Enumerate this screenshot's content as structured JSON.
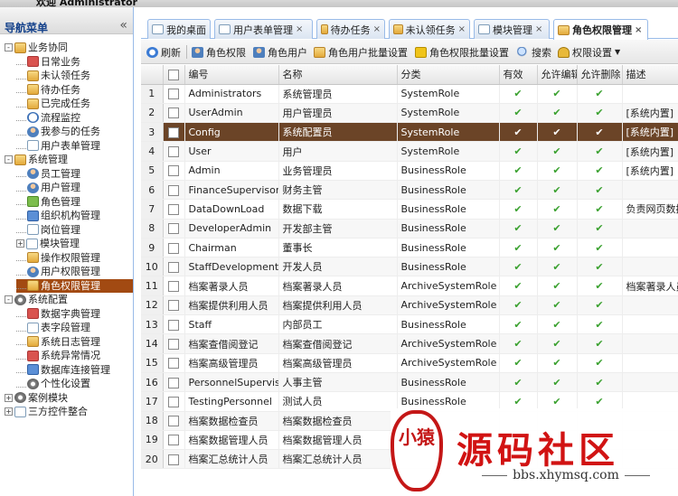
{
  "header": {
    "welcome": "欢迎 Administrator"
  },
  "nav": {
    "title": "导航菜单",
    "collapse_glyph": "«",
    "tree": [
      {
        "label": "业务协同",
        "level": 0,
        "toggle": "-",
        "icon": "folder"
      },
      {
        "label": "日常业务",
        "level": 1,
        "icon": "red"
      },
      {
        "label": "未认领任务",
        "level": 1,
        "icon": "folder"
      },
      {
        "label": "待办任务",
        "level": 1,
        "icon": "folder"
      },
      {
        "label": "已完成任务",
        "level": 1,
        "icon": "folder"
      },
      {
        "label": "流程监控",
        "level": 1,
        "icon": "clock"
      },
      {
        "label": "我参与的任务",
        "level": 1,
        "icon": "user"
      },
      {
        "label": "用户表单管理",
        "level": 1,
        "icon": "page"
      },
      {
        "label": "系统管理",
        "level": 0,
        "toggle": "-",
        "icon": "folder"
      },
      {
        "label": "员工管理",
        "level": 1,
        "icon": "user"
      },
      {
        "label": "用户管理",
        "level": 1,
        "icon": "user"
      },
      {
        "label": "角色管理",
        "level": 1,
        "icon": "green"
      },
      {
        "label": "组织机构管理",
        "level": 1,
        "icon": "blue"
      },
      {
        "label": "岗位管理",
        "level": 1,
        "icon": "page"
      },
      {
        "label": "模块管理",
        "level": 1,
        "toggle": "+",
        "icon": "page"
      },
      {
        "label": "操作权限管理",
        "level": 1,
        "icon": "folder"
      },
      {
        "label": "用户权限管理",
        "level": 1,
        "icon": "user"
      },
      {
        "label": "角色权限管理",
        "level": 1,
        "icon": "folder",
        "selected": true
      },
      {
        "label": "系统配置",
        "level": 0,
        "toggle": "-",
        "icon": "gear"
      },
      {
        "label": "数据字典管理",
        "level": 1,
        "icon": "red"
      },
      {
        "label": "表字段管理",
        "level": 1,
        "icon": "page"
      },
      {
        "label": "系统日志管理",
        "level": 1,
        "icon": "folder"
      },
      {
        "label": "系统异常情况",
        "level": 1,
        "icon": "red"
      },
      {
        "label": "数据库连接管理",
        "level": 1,
        "icon": "blue"
      },
      {
        "label": "个性化设置",
        "level": 1,
        "icon": "gear"
      },
      {
        "label": "案例模块",
        "level": 0,
        "toggle": "+",
        "icon": "gear"
      },
      {
        "label": "三方控件整合",
        "level": 0,
        "toggle": "+",
        "icon": "page"
      }
    ]
  },
  "tabs": [
    {
      "label": "我的桌面",
      "icon": "page",
      "closable": false
    },
    {
      "label": "用户表单管理",
      "icon": "page",
      "closable": true
    },
    {
      "label": "待办任务",
      "icon": "folder",
      "closable": true
    },
    {
      "label": "未认领任务",
      "icon": "folder",
      "closable": true
    },
    {
      "label": "模块管理",
      "icon": "page",
      "closable": true
    },
    {
      "label": "角色权限管理",
      "icon": "folder",
      "closable": true,
      "active": true
    }
  ],
  "toolbar": {
    "refresh": "刷新",
    "role_permission": "角色权限",
    "role_user": "角色用户",
    "role_user_batch": "角色用户批量设置",
    "role_permission_batch": "角色权限批量设置",
    "search": "搜索",
    "permission_settings": "权限设置"
  },
  "grid": {
    "columns": [
      "编号",
      "名称",
      "分类",
      "有效",
      "允许编辑",
      "允许删除",
      "描述"
    ],
    "check_glyph": "✔",
    "selected_row": 3,
    "rows": [
      {
        "n": "1",
        "code": "Administrators",
        "name": "系统管理员",
        "cat": "SystemRole",
        "valid": true,
        "edit": true,
        "del": true,
        "desc": ""
      },
      {
        "n": "2",
        "code": "UserAdmin",
        "name": "用户管理员",
        "cat": "SystemRole",
        "valid": true,
        "edit": true,
        "del": true,
        "desc": "[系统内置]"
      },
      {
        "n": "3",
        "code": "Config",
        "name": "系统配置员",
        "cat": "SystemRole",
        "valid": true,
        "edit": true,
        "del": true,
        "desc": "[系统内置]"
      },
      {
        "n": "4",
        "code": "User",
        "name": "用户",
        "cat": "SystemRole",
        "valid": true,
        "edit": true,
        "del": true,
        "desc": "[系统内置]"
      },
      {
        "n": "5",
        "code": "Admin",
        "name": "业务管理员",
        "cat": "BusinessRole",
        "valid": true,
        "edit": true,
        "del": true,
        "desc": "[系统内置]"
      },
      {
        "n": "6",
        "code": "FinanceSupervisor",
        "name": "财务主管",
        "cat": "BusinessRole",
        "valid": true,
        "edit": true,
        "del": true,
        "desc": ""
      },
      {
        "n": "7",
        "code": "DataDownLoad",
        "name": "数据下载",
        "cat": "BusinessRole",
        "valid": true,
        "edit": true,
        "del": true,
        "desc": "负责网页数据"
      },
      {
        "n": "8",
        "code": "DeveloperAdmin",
        "name": "开发部主管",
        "cat": "BusinessRole",
        "valid": true,
        "edit": true,
        "del": true,
        "desc": ""
      },
      {
        "n": "9",
        "code": "Chairman",
        "name": "董事长",
        "cat": "BusinessRole",
        "valid": true,
        "edit": true,
        "del": true,
        "desc": ""
      },
      {
        "n": "10",
        "code": "StaffDevelopment",
        "name": "开发人员",
        "cat": "BusinessRole",
        "valid": true,
        "edit": true,
        "del": true,
        "desc": ""
      },
      {
        "n": "11",
        "code": "档案著录人员",
        "name": "档案著录人员",
        "cat": "ArchiveSystemRole",
        "valid": true,
        "edit": true,
        "del": true,
        "desc": "档案著录人员"
      },
      {
        "n": "12",
        "code": "档案提供利用人员",
        "name": "档案提供利用人员",
        "cat": "ArchiveSystemRole",
        "valid": true,
        "edit": true,
        "del": true,
        "desc": ""
      },
      {
        "n": "13",
        "code": "Staff",
        "name": "内部员工",
        "cat": "BusinessRole",
        "valid": true,
        "edit": true,
        "del": true,
        "desc": ""
      },
      {
        "n": "14",
        "code": "档案查借阅登记",
        "name": "档案查借阅登记",
        "cat": "ArchiveSystemRole",
        "valid": true,
        "edit": true,
        "del": true,
        "desc": ""
      },
      {
        "n": "15",
        "code": "档案高级管理员",
        "name": "档案高级管理员",
        "cat": "ArchiveSystemRole",
        "valid": true,
        "edit": true,
        "del": true,
        "desc": ""
      },
      {
        "n": "16",
        "code": "PersonnelSupervisor",
        "name": "人事主管",
        "cat": "BusinessRole",
        "valid": true,
        "edit": true,
        "del": true,
        "desc": ""
      },
      {
        "n": "17",
        "code": "TestingPersonnel",
        "name": "测试人员",
        "cat": "BusinessRole",
        "valid": true,
        "edit": true,
        "del": true,
        "desc": ""
      },
      {
        "n": "18",
        "code": "档案数据检查员",
        "name": "档案数据检查员",
        "cat": "",
        "valid": false,
        "edit": false,
        "del": false,
        "desc": ""
      },
      {
        "n": "19",
        "code": "档案数据管理人员",
        "name": "档案数据管理人员",
        "cat": "",
        "valid": false,
        "edit": false,
        "del": false,
        "desc": ""
      },
      {
        "n": "20",
        "code": "档案汇总统计人员",
        "name": "档案汇总统计人员",
        "cat": "",
        "valid": false,
        "edit": false,
        "del": false,
        "desc": ""
      }
    ]
  },
  "watermark": {
    "logo_text": "小猿",
    "title": "源码社区",
    "url": "bbs.xhymsq.com"
  }
}
